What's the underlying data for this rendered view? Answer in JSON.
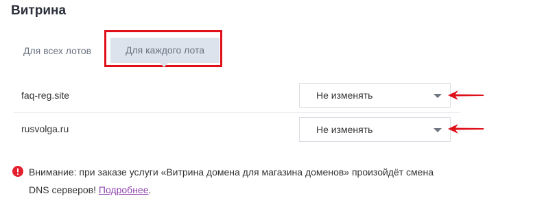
{
  "section": {
    "title": "Витрина"
  },
  "tabs": [
    {
      "label": "Для всех лотов",
      "active": false
    },
    {
      "label": "Для каждого лота",
      "active": true
    }
  ],
  "rows": [
    {
      "domain": "faq-reg.site",
      "select_value": "Не изменять"
    },
    {
      "domain": "rusvolga.ru",
      "select_value": "Не изменять"
    }
  ],
  "warning": {
    "icon": "exclamation-circle-icon",
    "text": "Внимание: при заказе услуги «Витрина домена для магазина доменов» произойдёт смена DNS серверов! ",
    "link_label": "Подробнее",
    "suffix": "."
  },
  "colors": {
    "highlight": "#e0101a",
    "active_tab_bg": "#dde3ec",
    "link": "#8e44ad",
    "warning_icon": "#e5202e",
    "annotation_arrow": "#e0101a"
  }
}
